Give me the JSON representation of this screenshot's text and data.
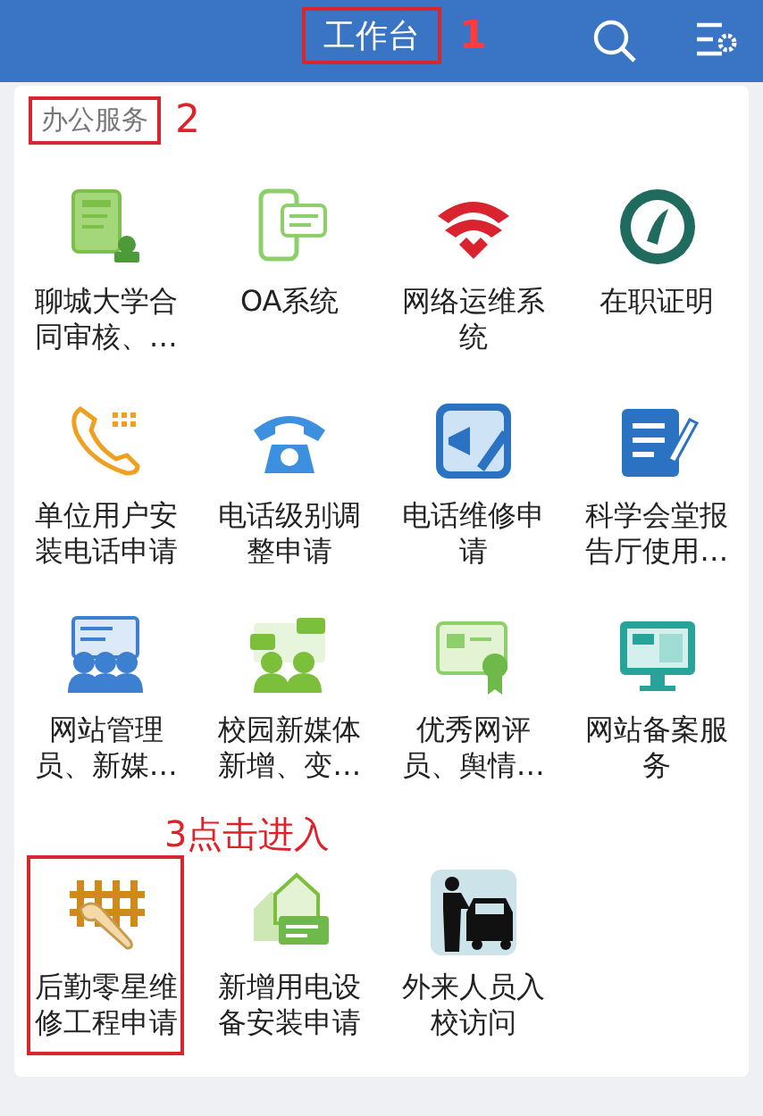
{
  "header": {
    "title": "工作台",
    "title_note": "1"
  },
  "section": {
    "title": "办公服务",
    "title_note": "2"
  },
  "items_note": "3点击进入",
  "items": [
    {
      "label": "聊城大学合同审核、…",
      "boxed": false
    },
    {
      "label": "OA系统",
      "boxed": false
    },
    {
      "label": "网络运维系统",
      "boxed": false
    },
    {
      "label": "在职证明",
      "boxed": false
    },
    {
      "label": "单位用户安装电话申请",
      "boxed": false
    },
    {
      "label": "电话级别调整申请",
      "boxed": false
    },
    {
      "label": "电话维修申请",
      "boxed": false
    },
    {
      "label": "科学会堂报告厅使用…",
      "boxed": false
    },
    {
      "label": "网站管理员、新媒…",
      "boxed": false
    },
    {
      "label": "校园新媒体新增、变…",
      "boxed": false
    },
    {
      "label": "优秀网评员、舆情…",
      "boxed": false
    },
    {
      "label": "网站备案服务",
      "boxed": false
    },
    {
      "label": "后勤零星维修工程申请",
      "boxed": true
    },
    {
      "label": "新增用电设备安装申请",
      "boxed": false
    },
    {
      "label": "外来人员入校访问",
      "boxed": false
    }
  ]
}
